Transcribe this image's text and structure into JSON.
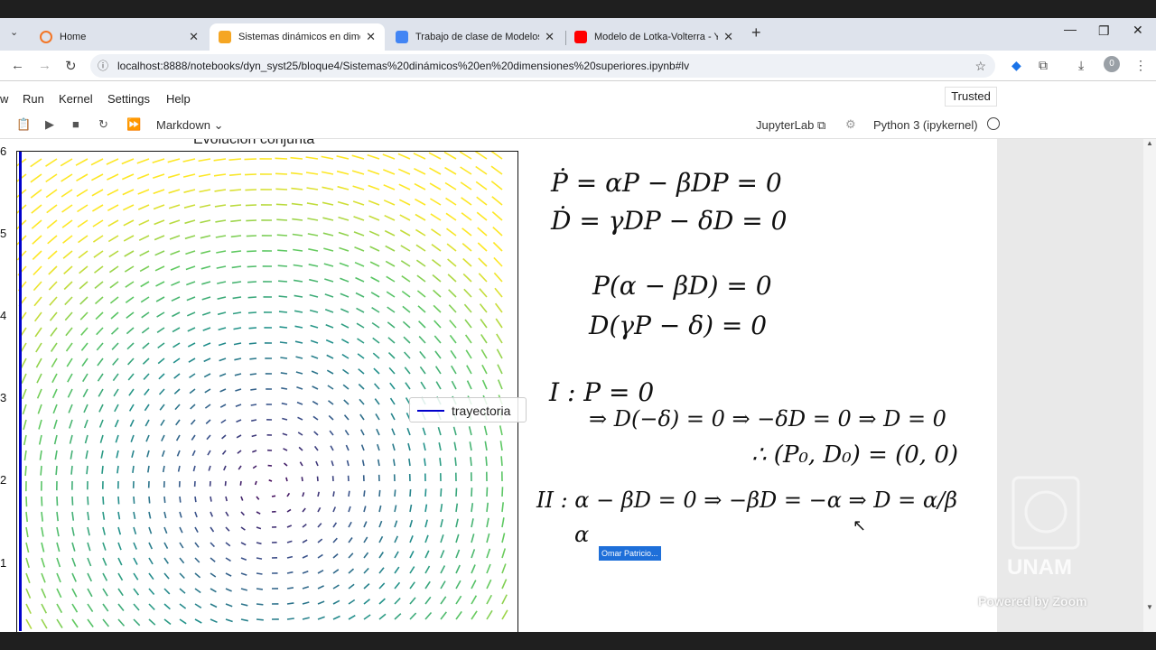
{
  "browser": {
    "tabs": [
      {
        "title": "Home",
        "favicon_color": "#f37626",
        "active": false
      },
      {
        "title": "Sistemas dinámicos en dimensi",
        "favicon_color": "#f5a623",
        "active": true
      },
      {
        "title": "Trabajo de clase de Modelos C",
        "favicon_color": "#4285f4",
        "active": false
      },
      {
        "title": "Modelo de Lotka-Volterra - You",
        "favicon_color": "#ff0000",
        "active": false
      }
    ],
    "new_tab": "+",
    "url": "localhost:8888/notebooks/dyn_syst25/bloque4/Sistemas%20dinámicos%20en%20dimensiones%20superiores.ipynb#lv",
    "profile_badge": "0"
  },
  "jupyter": {
    "menu": [
      "w",
      "Run",
      "Kernel",
      "Settings",
      "Help"
    ],
    "trusted": "Trusted",
    "cell_type": "Markdown",
    "jupyterlab_link": "JupyterLab",
    "kernel": "Python 3 (ipykernel)"
  },
  "plot": {
    "title": "Evolución conjunta",
    "yticks": [
      "6",
      "5",
      "4",
      "3",
      "2",
      "1"
    ],
    "legend": "trayectoria",
    "line_color": "#0000cc"
  },
  "handwriting": {
    "eq1": "Ṗ = αP − βDP = 0",
    "eq2": "Ḋ = γDP − δD = 0",
    "eq3": "P(α − βD) = 0",
    "eq4": "D(γP − δ) = 0",
    "case1": "I : P = 0",
    "case1b": "⇒ D(−δ) = 0 ⇒ −δD = 0 ⇒ D = 0",
    "case1c": "∴ (P₀, D₀) = (0, 0)",
    "case2": "II : α − βD = 0 ⇒ −βD = −α ⇒ D = α/β",
    "partial": "α"
  },
  "cursor_label": "Omar Patricio...",
  "watermark": {
    "logo_text": "UNAM",
    "zoom_text": "Powered by Zoom"
  }
}
